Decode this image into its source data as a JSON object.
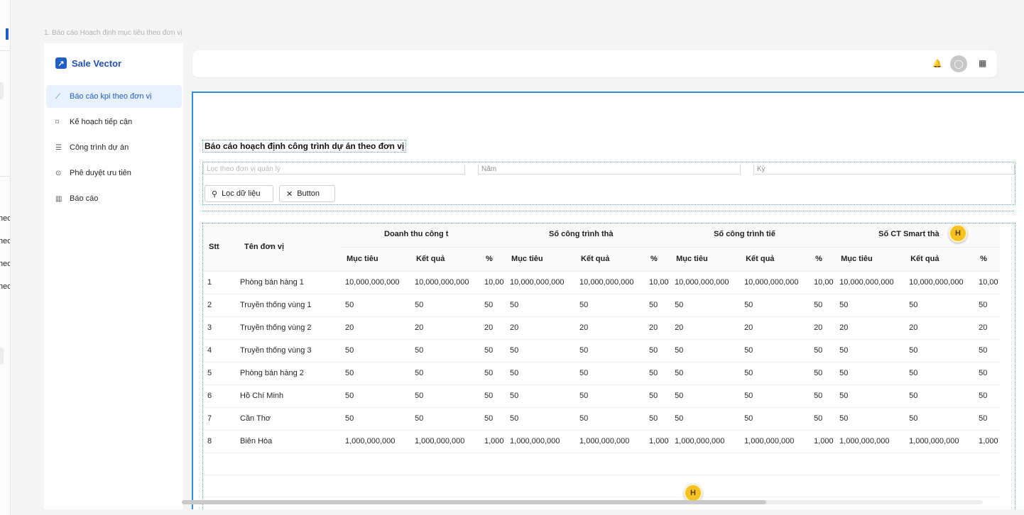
{
  "breadcrumb": "1. Báo cáo Hoạch định mục tiêu theo đơn vị",
  "left_strip_fragments": [
    "heo",
    "heo",
    "heo",
    "heo"
  ],
  "app": {
    "logo_text": "Sale Vector",
    "logo_glyph": "↗"
  },
  "sidebar": {
    "items": [
      {
        "label": "Báo cáo kpi theo đơn vị",
        "icon": "line-chart-icon",
        "glyph": "⟋",
        "active": true
      },
      {
        "label": "Kế hoạch tiếp cận",
        "icon": "diagram-icon",
        "glyph": "⌑",
        "active": false
      },
      {
        "label": "Công trình dự án",
        "icon": "list-icon",
        "glyph": "☰",
        "active": false
      },
      {
        "label": "Phê duyệt ưu tiên",
        "icon": "check-circle-icon",
        "glyph": "⊙",
        "active": false
      },
      {
        "label": "Báo cáo",
        "icon": "bar-chart-icon",
        "glyph": "▥",
        "active": false
      }
    ]
  },
  "topbar": {
    "bell_glyph": "🔔",
    "avatar_glyph": "◯",
    "grid_glyph": "▦"
  },
  "page": {
    "title": "Báo cáo hoạch định công trình dự án theo đơn vị"
  },
  "filters": {
    "unit_placeholder": "Lọc theo đơn vị quản lý",
    "year_placeholder": "Năm",
    "period_placeholder": "Kỳ",
    "filter_button": "Lọc dữ liệu",
    "filter_icon": "⚲",
    "extra_button": "Button",
    "extra_icon": "✕"
  },
  "table": {
    "col_stt": "Stt",
    "col_unit": "Tên đơn vị",
    "groups": [
      "Doanh thu công t",
      "Số công trình thà",
      "Số công trình tiế",
      "Số CT Smart thà"
    ],
    "sub": [
      "Mục tiêu",
      "Kết quả",
      "%"
    ],
    "rows": [
      {
        "stt": "1",
        "unit": "Phòng bán hàng 1",
        "cells": [
          "10,000,000,000",
          "10,000,000,000",
          "10,00",
          "10,000,000,000",
          "10,000,000,000",
          "10,00",
          "10,000,000,000",
          "10,000,000,000",
          "10,00",
          "10,000,000,000",
          "10,000,000,000",
          "10,00"
        ]
      },
      {
        "stt": "2",
        "unit": "Truyền thống vùng 1",
        "cells": [
          "50",
          "50",
          "50",
          "50",
          "50",
          "50",
          "50",
          "50",
          "50",
          "50",
          "50",
          "50"
        ]
      },
      {
        "stt": "3",
        "unit": "Truyền thống vùng 2",
        "cells": [
          "20",
          "20",
          "20",
          "20",
          "20",
          "20",
          "20",
          "20",
          "20",
          "20",
          "20",
          "20"
        ]
      },
      {
        "stt": "4",
        "unit": "Truyền thống vùng 3",
        "cells": [
          "50",
          "50",
          "50",
          "50",
          "50",
          "50",
          "50",
          "50",
          "50",
          "50",
          "50",
          "50"
        ]
      },
      {
        "stt": "5",
        "unit": "Phòng bán hàng 2",
        "cells": [
          "50",
          "50",
          "50",
          "50",
          "50",
          "50",
          "50",
          "50",
          "50",
          "50",
          "50",
          "50"
        ]
      },
      {
        "stt": "6",
        "unit": "Hồ Chí Minh",
        "cells": [
          "50",
          "50",
          "50",
          "50",
          "50",
          "50",
          "50",
          "50",
          "50",
          "50",
          "50",
          "50"
        ]
      },
      {
        "stt": "7",
        "unit": "Cần Thơ",
        "cells": [
          "50",
          "50",
          "50",
          "50",
          "50",
          "50",
          "50",
          "50",
          "50",
          "50",
          "50",
          "50"
        ]
      },
      {
        "stt": "8",
        "unit": "Biên Hòa",
        "cells": [
          "1,000,000,000",
          "1,000,000,000",
          "1,000",
          "1,000,000,000",
          "1,000,000,000",
          "1,000",
          "1,000,000,000",
          "1,000,000,000",
          "1,000",
          "1,000,000,000",
          "1,000,000,000",
          "1,000"
        ]
      }
    ]
  },
  "badges": [
    "H",
    "H"
  ],
  "colors": {
    "accent": "#1f5fc6",
    "selection": "#2f8fe0",
    "badge": "#f7c21f",
    "active_bg": "#e8f1fd"
  },
  "scrollbar": {
    "position_fraction": 0.73
  }
}
